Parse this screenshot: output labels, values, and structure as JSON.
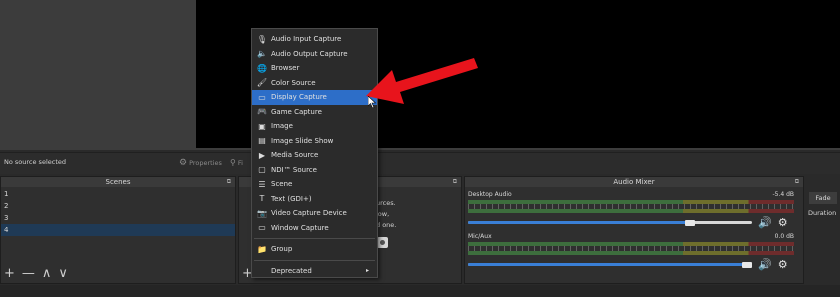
{
  "toolbar": {
    "no_source_text": "No source selected",
    "properties_label": "Properties",
    "filters_label": "Fi"
  },
  "scenes": {
    "title": "Scenes",
    "items": [
      "1",
      "2",
      "3",
      "4"
    ],
    "selected_index": 3,
    "footer_icons": [
      "+",
      "—",
      "∧",
      "∨"
    ]
  },
  "sources": {
    "hint_lines": [
      "urces.",
      "low,",
      "d one."
    ],
    "add_icon": "+"
  },
  "context_menu": {
    "items": [
      {
        "label": "Audio Input Capture",
        "icon": "microphone-icon",
        "glyph": "🎙"
      },
      {
        "label": "Audio Output Capture",
        "icon": "speaker-icon",
        "glyph": "🔈"
      },
      {
        "label": "Browser",
        "icon": "globe-icon",
        "glyph": "🌐"
      },
      {
        "label": "Color Source",
        "icon": "brush-icon",
        "glyph": "🖌"
      },
      {
        "label": "Display Capture",
        "icon": "monitor-icon",
        "glyph": "▭"
      },
      {
        "label": "Game Capture",
        "icon": "gamepad-icon",
        "glyph": "🎮"
      },
      {
        "label": "Image",
        "icon": "image-icon",
        "glyph": "▣"
      },
      {
        "label": "Image Slide Show",
        "icon": "slideshow-icon",
        "glyph": "▤"
      },
      {
        "label": "Media Source",
        "icon": "play-icon",
        "glyph": "▶"
      },
      {
        "label": "NDI™ Source",
        "icon": "ndi-icon",
        "glyph": "▢"
      },
      {
        "label": "Scene",
        "icon": "list-icon",
        "glyph": "☰"
      },
      {
        "label": "Text (GDI+)",
        "icon": "text-icon",
        "glyph": "T"
      },
      {
        "label": "Video Capture Device",
        "icon": "camera-icon",
        "glyph": "📷"
      },
      {
        "label": "Window Capture",
        "icon": "window-icon",
        "glyph": "▭"
      }
    ],
    "group_label": "Group",
    "group_glyph": "📁",
    "deprecated_label": "Deprecated",
    "submenu_arrow": "▸",
    "highlighted_index": 4
  },
  "mixer": {
    "title": "Audio Mixer",
    "channels": [
      {
        "name": "Desktop Audio",
        "db": "-5.4 dB",
        "volume": 0.8
      },
      {
        "name": "Mic/Aux",
        "db": "0.0 dB",
        "volume": 1.0
      }
    ],
    "volume_glyph": "🔊",
    "gear_glyph": "⚙"
  },
  "transitions": {
    "fade_label": "Fade",
    "duration_label": "Duration"
  },
  "colors": {
    "highlight": "#2d6ec8",
    "annotation_arrow": "#e8141c"
  }
}
